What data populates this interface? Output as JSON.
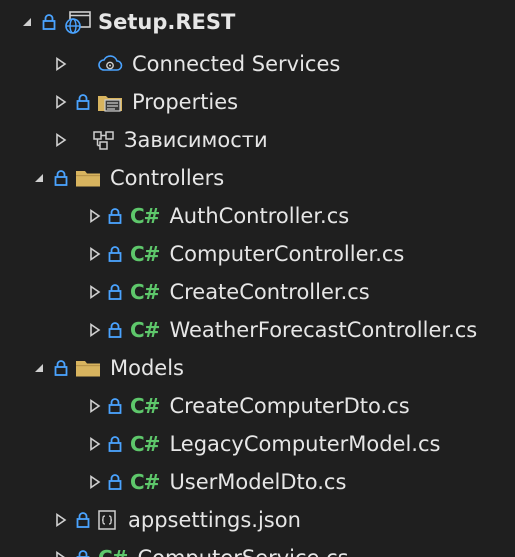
{
  "colors": {
    "background": "#1f1f1f",
    "text": "#e6e6e6",
    "lock": "#4aa3ff",
    "csharp": "#5ec76b",
    "folder": "#d8b45f",
    "chevron": "#cfcfcf"
  },
  "tree": {
    "project": {
      "label": "Setup.REST",
      "icon": "web-project-icon"
    },
    "connected_services": {
      "label": "Connected Services",
      "icon": "connected-services-icon"
    },
    "properties": {
      "label": "Properties",
      "icon": "properties-folder-icon"
    },
    "dependencies": {
      "label": "Зависимости",
      "icon": "dependencies-icon"
    },
    "controllers": {
      "label": "Controllers",
      "icon": "folder-icon",
      "files": [
        {
          "label": "AuthController.cs"
        },
        {
          "label": "ComputerController.cs"
        },
        {
          "label": "CreateController.cs"
        },
        {
          "label": "WeatherForecastController.cs"
        }
      ]
    },
    "models": {
      "label": "Models",
      "icon": "folder-icon",
      "files": [
        {
          "label": "CreateComputerDto.cs"
        },
        {
          "label": "LegacyComputerModel.cs"
        },
        {
          "label": "UserModelDto.cs"
        }
      ]
    },
    "appsettings": {
      "label": "appsettings.json",
      "icon": "json-file-icon"
    },
    "computer_service": {
      "label": "ComputerService.cs"
    }
  },
  "csharp_badge": "C#"
}
